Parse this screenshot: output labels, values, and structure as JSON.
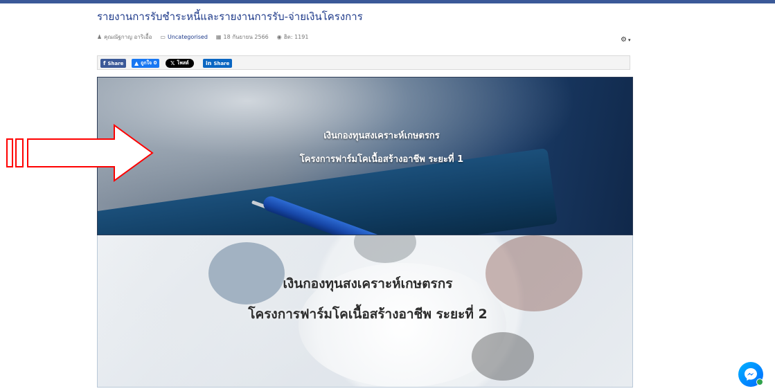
{
  "article": {
    "title": "รายงานการรับชำระหนี้และรายงานการรับ-จ่ายเงินโครงการ",
    "meta": {
      "author": "คุณณัฐกาญ อาริเอื้อ",
      "category": "Uncategorised",
      "date": "18 กันยายน 2566",
      "hits": "ฮิต: 1191"
    }
  },
  "share": {
    "facebook": "Share",
    "like": "ถูกใจ 0",
    "x": "โพสต์",
    "linkedin": "Share"
  },
  "banners": [
    {
      "line1": "เงินกองทุนสงเคราะห์เกษตรกร",
      "line2": "โครงการฟาร์มโคเนื้อสร้างอาชีพ ระยะที่ 1"
    },
    {
      "line1": "เงินกองทุนสงเคราะห์เกษตรกร",
      "line2": "โครงการฟาร์มโคเนื้อสร้างอาชีพ ระยะที่ 2"
    }
  ],
  "icons": {
    "author": "user-icon",
    "category": "folder-icon",
    "date": "calendar-icon",
    "hits": "eye-icon",
    "tools": "gear-icon",
    "chat": "messenger-icon",
    "pointer": "arrow-icon"
  },
  "colors": {
    "title": "#1e3a8a",
    "facebook": "#3b5998",
    "like": "#1877f2",
    "linkedin": "#0a66c2",
    "arrow": "#ff0000",
    "messenger": "#0084ff"
  }
}
